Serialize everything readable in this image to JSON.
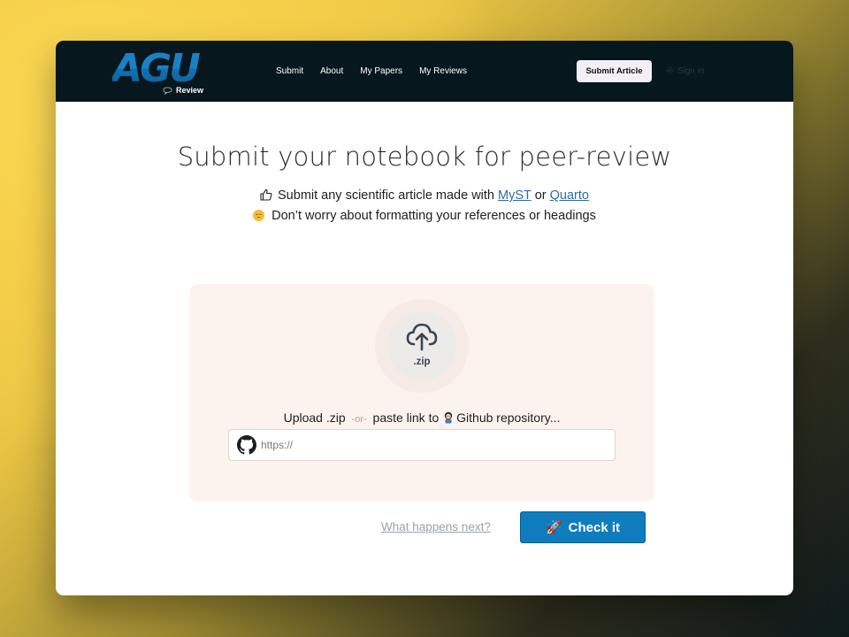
{
  "brand": {
    "logo_text": "AGU",
    "logo_subtitle": "Review"
  },
  "nav": {
    "links": [
      "Submit",
      "About",
      "My Papers",
      "My Reviews"
    ],
    "submit_button": "Submit Article",
    "sign_in": "Sign in"
  },
  "main": {
    "title": "Submit your notebook for peer-review",
    "line1_prefix": "Submit any scientific article made with",
    "link_myst": "MyST",
    "line1_or": "or",
    "link_quarto": "Quarto",
    "line2": "Don’t worry about formatting your references or headings"
  },
  "upload": {
    "file_type": ".zip",
    "text_prefix": "Upload .zip",
    "text_or": "-or-",
    "text_suffix_before_icon": "paste link to",
    "text_suffix": "Github repository...",
    "url_placeholder": "https://",
    "url_value": ""
  },
  "actions": {
    "next_link": "What happens next?",
    "check_button": "Check it"
  },
  "colors": {
    "navbar_bg": "#07171e",
    "accent_blue": "#0f7cbd",
    "upload_bg": "#fdf3ee",
    "link_blue": "#2b6ca8"
  }
}
